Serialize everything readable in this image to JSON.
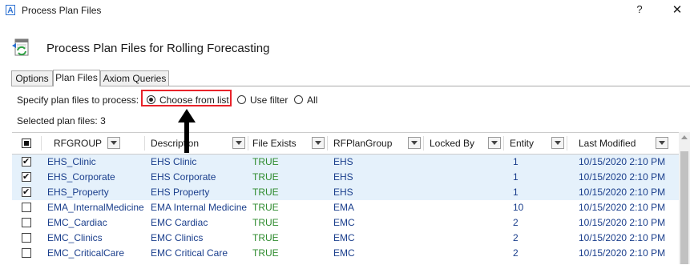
{
  "window": {
    "app_icon_letter": "A",
    "title": "Process Plan Files",
    "help": "?",
    "close": "✕"
  },
  "header": {
    "title": "Process Plan Files for Rolling Forecasting",
    "icon": "refresh-files-icon"
  },
  "tabs": [
    {
      "label": "Options",
      "active": false
    },
    {
      "label": "Plan Files",
      "active": true
    },
    {
      "label": "Axiom Queries",
      "active": false
    }
  ],
  "specify": {
    "label": "Specify plan files to process:",
    "options": [
      {
        "label": "Choose from list",
        "checked": true
      },
      {
        "label": "Use filter",
        "checked": false
      },
      {
        "label": "All",
        "checked": false
      }
    ]
  },
  "selected_count": "Selected plan files: 3",
  "grid": {
    "columns": [
      "RFGROUP",
      "Description",
      "File Exists",
      "RFPlanGroup",
      "Locked By",
      "Entity",
      "Last Modified"
    ],
    "rows": [
      {
        "checked": true,
        "selected": true,
        "cells": [
          "EHS_Clinic",
          "EHS Clinic",
          "TRUE",
          "EHS",
          "",
          "1",
          "10/15/2020 2:10 PM"
        ]
      },
      {
        "checked": true,
        "selected": true,
        "cells": [
          "EHS_Corporate",
          "EHS Corporate",
          "TRUE",
          "EHS",
          "",
          "1",
          "10/15/2020 2:10 PM"
        ]
      },
      {
        "checked": true,
        "selected": true,
        "cells": [
          "EHS_Property",
          "EHS Property",
          "TRUE",
          "EHS",
          "",
          "1",
          "10/15/2020 2:10 PM"
        ]
      },
      {
        "checked": false,
        "selected": false,
        "cells": [
          "EMA_InternalMedicine",
          "EMA Internal Medicine",
          "TRUE",
          "EMA",
          "",
          "10",
          "10/15/2020 2:10 PM"
        ]
      },
      {
        "checked": false,
        "selected": false,
        "cells": [
          "EMC_Cardiac",
          "EMC Cardiac",
          "TRUE",
          "EMC",
          "",
          "2",
          "10/15/2020 2:10 PM"
        ]
      },
      {
        "checked": false,
        "selected": false,
        "cells": [
          "EMC_Clinics",
          "EMC Clinics",
          "TRUE",
          "EMC",
          "",
          "2",
          "10/15/2020 2:10 PM"
        ]
      },
      {
        "checked": false,
        "selected": false,
        "cells": [
          "EMC_CriticalCare",
          "EMC Critical Care",
          "TRUE",
          "EMC",
          "",
          "2",
          "10/15/2020 2:10 PM"
        ]
      }
    ]
  },
  "colors": {
    "highlight": "#e8232a",
    "selected_row": "#e5f1fb",
    "true_text": "#2e8b2e",
    "link_text": "#1a3e8c"
  }
}
